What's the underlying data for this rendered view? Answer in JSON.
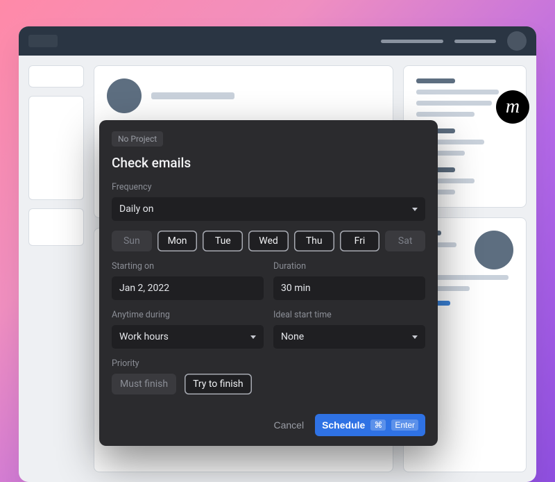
{
  "brand_glyph": "m",
  "modal": {
    "project_chip": "No Project",
    "title": "Check emails",
    "frequency": {
      "label": "Frequency",
      "value": "Daily on"
    },
    "days": [
      {
        "abbr": "Sun",
        "selected": false
      },
      {
        "abbr": "Mon",
        "selected": true
      },
      {
        "abbr": "Tue",
        "selected": true
      },
      {
        "abbr": "Wed",
        "selected": true
      },
      {
        "abbr": "Thu",
        "selected": true
      },
      {
        "abbr": "Fri",
        "selected": true
      },
      {
        "abbr": "Sat",
        "selected": false
      }
    ],
    "starting_on": {
      "label": "Starting on",
      "value": "Jan 2, 2022"
    },
    "duration": {
      "label": "Duration",
      "value": "30 min"
    },
    "anytime_during": {
      "label": "Anytime during",
      "value": "Work hours"
    },
    "ideal_start": {
      "label": "Ideal start time",
      "value": "None"
    },
    "priority": {
      "label": "Priority",
      "options": [
        "Must finish",
        "Try to finish"
      ],
      "selected": "Try to finish"
    },
    "footer": {
      "cancel": "Cancel",
      "submit": "Schedule",
      "shortcut_mod": "⌘",
      "shortcut_key": "Enter"
    }
  }
}
